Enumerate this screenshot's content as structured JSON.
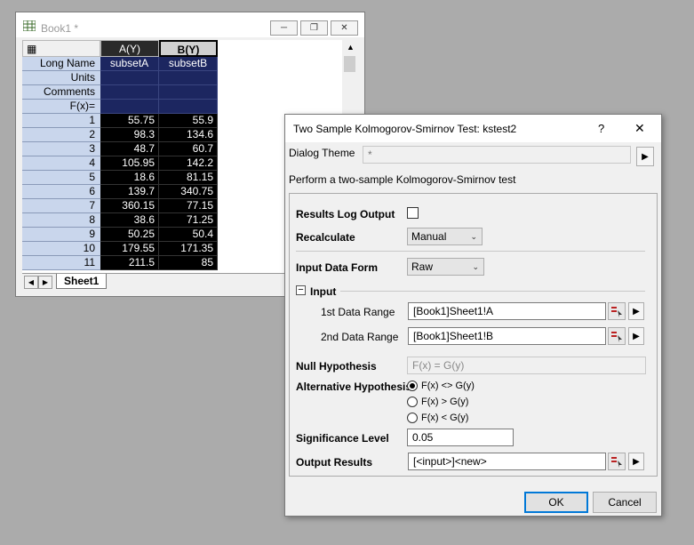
{
  "workbook": {
    "title": "Book1 *",
    "col_a": "A(Y)",
    "col_b": "B(Y)",
    "meta_rows": [
      {
        "label": "Long Name",
        "a": "subsetA",
        "b": "subsetB"
      },
      {
        "label": "Units",
        "a": "",
        "b": ""
      },
      {
        "label": "Comments",
        "a": "",
        "b": ""
      },
      {
        "label": "F(x)=",
        "a": "",
        "b": ""
      }
    ],
    "rows": [
      {
        "n": "1",
        "a": "55.75",
        "b": "55.9"
      },
      {
        "n": "2",
        "a": "98.3",
        "b": "134.6"
      },
      {
        "n": "3",
        "a": "48.7",
        "b": "60.7"
      },
      {
        "n": "4",
        "a": "105.95",
        "b": "142.2"
      },
      {
        "n": "5",
        "a": "18.6",
        "b": "81.15"
      },
      {
        "n": "6",
        "a": "139.7",
        "b": "340.75"
      },
      {
        "n": "7",
        "a": "360.15",
        "b": "77.15"
      },
      {
        "n": "8",
        "a": "38.6",
        "b": "71.25"
      },
      {
        "n": "9",
        "a": "50.25",
        "b": "50.4"
      },
      {
        "n": "10",
        "a": "179.55",
        "b": "171.35"
      },
      {
        "n": "11",
        "a": "211.5",
        "b": "85"
      }
    ],
    "sheet_tab": "Sheet1"
  },
  "dialog": {
    "title": "Two Sample Kolmogorov-Smirnov Test: kstest2",
    "help": "?",
    "close": "✕",
    "theme_label": "Dialog Theme",
    "theme_value": "*",
    "description": "Perform a two-sample Kolmogorov-Smirnov test",
    "results_log_label": "Results Log Output",
    "recalculate_label": "Recalculate",
    "recalculate_value": "Manual",
    "input_form_label": "Input Data Form",
    "input_form_value": "Raw",
    "input_group": "Input",
    "range1_label": "1st Data Range",
    "range1_value": "[Book1]Sheet1!A",
    "range2_label": "2nd Data Range",
    "range2_value": "[Book1]Sheet1!B",
    "null_label": "Null Hypothesis",
    "null_value": "F(x) = G(y)",
    "alt_label": "Alternative Hypothesis",
    "alt_options": [
      "F(x) <> G(y)",
      "F(x) > G(y)",
      "F(x) < G(y)"
    ],
    "sig_label": "Significance Level",
    "sig_value": "0.05",
    "output_label": "Output Results",
    "output_value": "[<input>]<new>",
    "ok": "OK",
    "cancel": "Cancel"
  }
}
